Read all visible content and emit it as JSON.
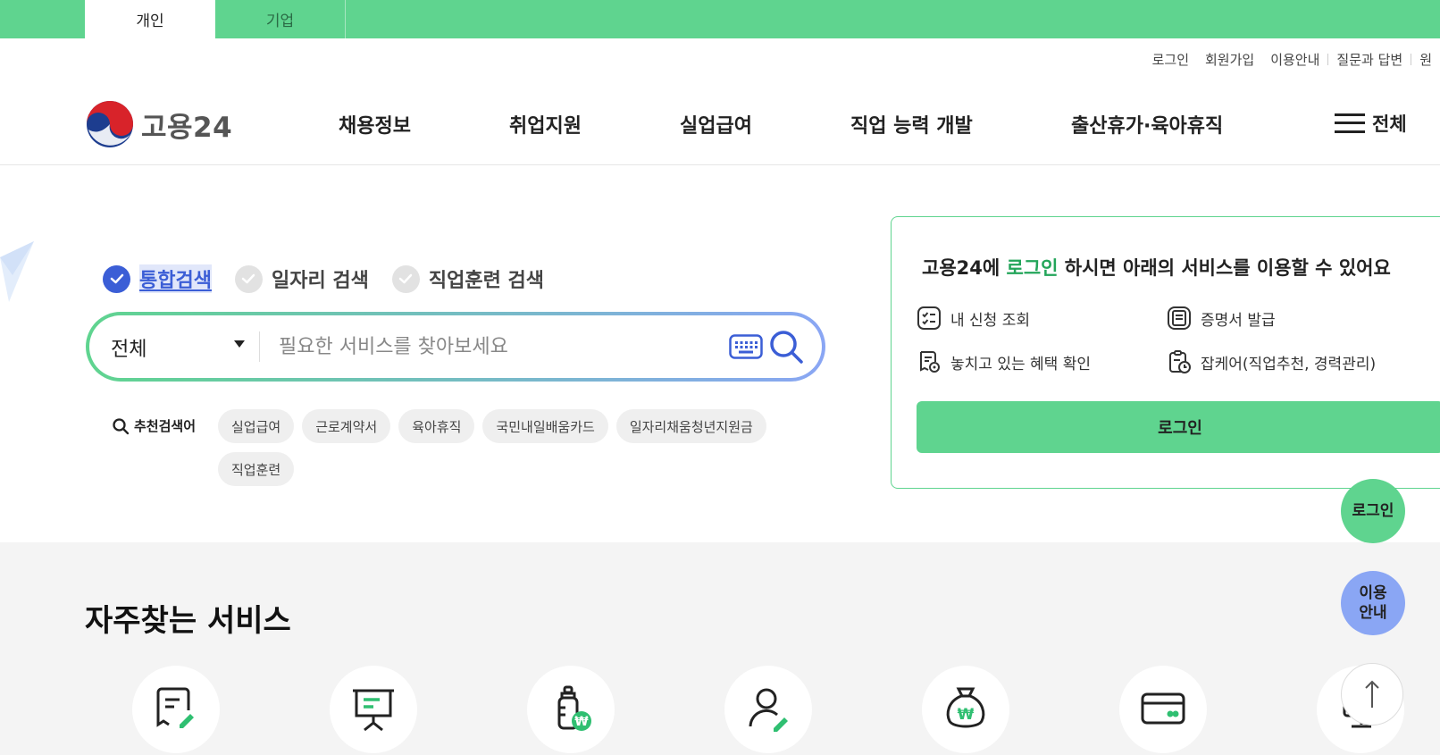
{
  "top_tabs": [
    {
      "label": "개인",
      "active": true
    },
    {
      "label": "기업",
      "active": false
    }
  ],
  "util_links": [
    "로그인",
    "회원가입",
    "이용안내",
    "질문과 답변",
    "원"
  ],
  "logo": {
    "text": "고용24"
  },
  "gnb": [
    "채용정보",
    "취업지원",
    "실업급여",
    "직업 능력 개발",
    "출산휴가·육아휴직"
  ],
  "menu_label": "전체",
  "search": {
    "tabs": [
      "통합검색",
      "일자리 검색",
      "직업훈련 검색"
    ],
    "category": "전체",
    "placeholder": "필요한 서비스를 찾아보세요",
    "recommend_title": "추천검색어",
    "chips": [
      "실업급여",
      "근로계약서",
      "육아휴직",
      "국민내일배움카드",
      "일자리채움청년지원금",
      "직업훈련"
    ]
  },
  "login_box": {
    "title_prefix": "고용24에 ",
    "title_emph": "로그인",
    "title_suffix": " 하시면 아래의 서비스를 이용할 수 있어요",
    "items": [
      "내 신청 조회",
      "증명서 발급",
      "놓치고 있는 혜택 확인",
      "잡케어(직업추천, 경력관리)"
    ],
    "button": "로그인"
  },
  "fabs": {
    "login": "로그인",
    "guide_line1": "이용",
    "guide_line2": "안내"
  },
  "frequent": {
    "title": "자주찾는 서비스"
  },
  "colors": {
    "brand_green": "#5fd48f",
    "accent_blue": "#3b5ed6",
    "soft_blue": "#8aa6f4"
  }
}
